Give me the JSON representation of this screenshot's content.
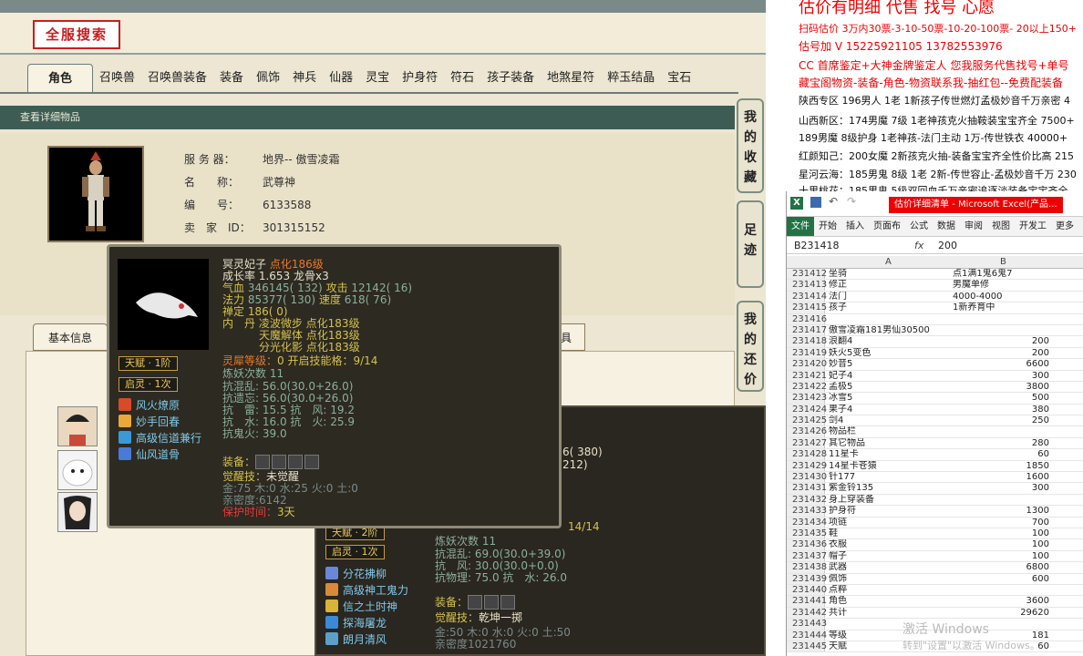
{
  "game": {
    "search_button": "全服搜索",
    "tabs": [
      "角色",
      "召唤兽",
      "召唤兽装备",
      "装备",
      "佩饰",
      "神兵",
      "仙器",
      "灵宝",
      "护身符",
      "符石",
      "孩子装备",
      "地煞星符",
      "粹玉结晶",
      "宝石"
    ],
    "detail_header": "查看详细物品",
    "info": [
      {
        "k": "服 务 器：",
        "v": "地界-- 傲雪凌霜"
      },
      {
        "k": "名　　称：",
        "v": "武尊神"
      },
      {
        "k": "编　　号：",
        "v": "6133588"
      },
      {
        "k": "卖　家　ID：",
        "v": "301315152"
      }
    ],
    "side_tabs": [
      "我的收藏",
      "足迹",
      "我的还价"
    ],
    "basic_tab": "基本信息",
    "tool_tab": "具"
  },
  "tooltip": {
    "name": "冥灵妃子",
    "dianhua": "点化186级",
    "growth": "成长率 1.653 龙骨x3",
    "qixue_label": "气血",
    "qixue": "346145( 132)",
    "gongji_label": "攻击",
    "gongji": "12142( 16)",
    "fali_label": "法力",
    "fali": "85377( 130)",
    "sudu_label": "速度",
    "sudu": "618( 76)",
    "chanding": "禅定 186( 0)",
    "neidan_label": "内　丹",
    "neidan": [
      "凌波微步 点化183级",
      "天魔解体 点化183级",
      "分光化影 点化183级"
    ],
    "linxi_label": "灵犀等级：",
    "linxi": "0 开启技能格：9/14",
    "lianyao": "炼妖次数 11",
    "res": [
      "抗混乱: 56.0(30.0+26.0)",
      "抗遗忘: 56.0(30.0+26.0)",
      "抗　雷: 15.5 抗　风: 19.2",
      "抗　水: 16.0 抗　火: 25.9",
      "抗鬼火: 39.0"
    ],
    "badges": [
      "天赋 · 1阶",
      "启灵 · 1次"
    ],
    "skills": [
      "风火燎原",
      "妙手回春",
      "高级信道兼行",
      "仙风道骨"
    ],
    "equip_label": "装备：",
    "awaken_label": "觉醒技：",
    "awaken": "未觉醒",
    "elements": "金:75 木:0 水:25 火:0 土:0",
    "intimacy": "亲密度:6142",
    "protect_label": "保护时间：",
    "protect": "3天"
  },
  "lower": {
    "badges": [
      "天赋 · 2阶",
      "启灵 · 1次"
    ],
    "skills": [
      "分花拂柳",
      "高级神工鬼力",
      "信之土时神",
      "探海屠龙",
      "朗月清风"
    ],
    "partial_top": [
      "6( 380)",
      "212)"
    ],
    "partial_cnt": "14/14",
    "lianyao": "炼妖次数 11",
    "res": [
      "抗混乱: 69.0(30.0+39.0)",
      "抗　风: 30.0(30.0+0.0)",
      "抗物理: 75.0 抗　水: 26.0"
    ],
    "equip_label": "装备：",
    "awaken_label": "觉醒技：",
    "awaken": "乾坤一掷",
    "elements": "金:50 木:0 水:0 火:0 土:50",
    "intimacy": "亲密度1021760"
  },
  "ads": [
    {
      "t": "估价有明细 代售 找号 心愿",
      "c": "red"
    },
    {
      "t": "扫码估价 3万内30票-3-10-50票-10-20-100票- 20以上150+",
      "c": "red"
    },
    {
      "t": "估号加 V 15225921105 13782553976",
      "c": "red"
    },
    {
      "t": "CC 首席鉴定+大神金牌鉴定人 您我服务代售找号+单号",
      "c": "red"
    },
    {
      "t": "藏宝阁物资-装备-角色-物资联系我-抽红包--免费配装备",
      "c": "red"
    },
    {
      "t": "陕西专区 196男人 1老 1新孩子传世燃灯孟极妙音千万亲密 4",
      "c": "blk"
    },
    {
      "t": "山西新区：174男魔 7级 1老神孩克火抽鞍装宝宝齐全 7500+",
      "c": "blk"
    },
    {
      "t": "189男魔 8级护身 1老神孩-法门主动 1万-传世铁衣 40000+",
      "c": "blk"
    },
    {
      "t": "红颜知己：200女魔 2新孩克火抽-装备宝宝齐全性价比高 215",
      "c": "blk"
    },
    {
      "t": "星河云海：185男鬼 8级 1老 2新-传世容止-孟极妙音千万 230",
      "c": "blk"
    },
    {
      "t": "十里桃花：185男鬼 5级双回血千万亲密追逐淡装备宝宝齐全",
      "c": "blk"
    }
  ],
  "excel": {
    "title": "估价详细清单 - Microsoft Excel(产品...",
    "ribbon": [
      "文件",
      "开始",
      "插入",
      "页面布",
      "公式",
      "数据",
      "审阅",
      "视图",
      "开发工",
      "更多"
    ],
    "namebox": "B231418",
    "fx": "fx",
    "formula": "200",
    "cols": [
      "A",
      "B"
    ],
    "rows": [
      [
        "231412",
        "坐骑",
        "点1满1鬼6鬼7"
      ],
      [
        "231413",
        "修正",
        "男魔单修"
      ],
      [
        "231414",
        "法门",
        "4000-4000"
      ],
      [
        "231415",
        "孩子",
        "1新养育中"
      ],
      [
        "231416",
        "",
        ""
      ],
      [
        "231417",
        "傲雪凌霜181男仙30500",
        ""
      ],
      [
        "231418",
        "浪翻4",
        "200"
      ],
      [
        "231419",
        "妖火5变色",
        "200"
      ],
      [
        "231420",
        "妙音5",
        "6600"
      ],
      [
        "231421",
        "妃子4",
        "300"
      ],
      [
        "231422",
        "孟极5",
        "3800"
      ],
      [
        "231423",
        "冰雪5",
        "500"
      ],
      [
        "231424",
        "果子4",
        "380"
      ],
      [
        "231425",
        "剑4",
        "250"
      ],
      [
        "231426",
        "物品栏",
        ""
      ],
      [
        "231427",
        "其它物品",
        "280"
      ],
      [
        "231428",
        "11星卡",
        "60"
      ],
      [
        "231429",
        "14星卡苍猿",
        "1850"
      ],
      [
        "231430",
        "针177",
        "1600"
      ],
      [
        "231431",
        "紫金铃135",
        "300"
      ],
      [
        "231432",
        "身上穿装备",
        ""
      ],
      [
        "231433",
        "护身符",
        "1300"
      ],
      [
        "231434",
        "项链",
        "700"
      ],
      [
        "231435",
        "鞋",
        "100"
      ],
      [
        "231436",
        "衣服",
        "100"
      ],
      [
        "231437",
        "帽子",
        "100"
      ],
      [
        "231438",
        "武器",
        "6800"
      ],
      [
        "231439",
        "佩饰",
        "600"
      ],
      [
        "231440",
        "点粹",
        ""
      ],
      [
        "231441",
        "角色",
        "3600"
      ],
      [
        "231442",
        "共计",
        "29620"
      ],
      [
        "231443",
        "",
        ""
      ],
      [
        "231444",
        "等级",
        "181"
      ],
      [
        "231445",
        "天赋",
        "60"
      ]
    ]
  },
  "watermark": "激活 Windows",
  "watermark2": "转到\"设置\"以激活 Windows。"
}
